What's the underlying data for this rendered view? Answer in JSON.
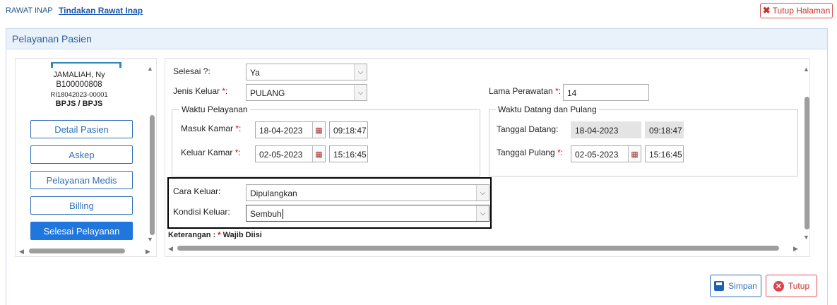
{
  "breadcrumb": {
    "root": "RAWAT INAP",
    "current": "Tindakan Rawat Inap"
  },
  "top_actions": {
    "close_page": "Tutup Halaman"
  },
  "panel": {
    "title": "Pelayanan Pasien"
  },
  "patient": {
    "name": "JAMALIAH, Ny",
    "rm_number": "B100000808",
    "registration": "RI18042023-00001",
    "payer": "BPJS / BPJS"
  },
  "side_menu": {
    "detail": "Detail Pasien",
    "askep": "Askep",
    "medis": "Pelayanan Medis",
    "billing": "Billing",
    "selesai": "Selesai Pelayanan"
  },
  "form": {
    "selesai": {
      "label": "Selesai ?:",
      "value": "Ya"
    },
    "jenis_keluar": {
      "label": "Jenis Keluar ",
      "value": "PULANG"
    },
    "lama_perawatan": {
      "label": "Lama Perawatan ",
      "value": "14"
    },
    "waktu_pelayanan": {
      "legend": "Waktu Pelayanan",
      "masuk_label": "Masuk Kamar ",
      "masuk_date": "18-04-2023",
      "masuk_time": "09:18:47",
      "keluar_label": "Keluar Kamar ",
      "keluar_date": "02-05-2023",
      "keluar_time": "15:16:45"
    },
    "waktu_datang_pulang": {
      "legend": "Waktu Datang dan Pulang",
      "datang_label": "Tanggal Datang:",
      "datang_date": "18-04-2023",
      "datang_time": "09:18:47",
      "pulang_label": "Tanggal Pulang ",
      "pulang_date": "02-05-2023",
      "pulang_time": "15:16:45"
    },
    "cara_keluar": {
      "label": "Cara Keluar:",
      "value": "Dipulangkan"
    },
    "kondisi_keluar": {
      "label": "Kondisi Keluar:",
      "value": "Sembuh"
    },
    "required_mark": "*",
    "colon": ":",
    "keterangan": {
      "prefix": "Keterangan : ",
      "star": "*",
      "suffix": " Wajib Diisi"
    }
  },
  "actions": {
    "save": "Simpan",
    "close": "Tutup"
  }
}
